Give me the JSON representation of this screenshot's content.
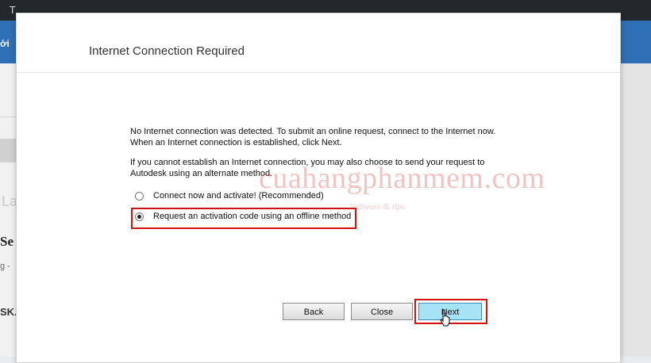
{
  "background": {
    "topbar_glyph": "T",
    "bluebar_text": "ới",
    "left_fragments": [
      "La",
      "Se",
      "g -",
      "SK."
    ]
  },
  "dialog": {
    "title": "Internet Connection Required",
    "message_1": "No Internet connection was detected. To submit an online request, connect to the Internet now. When an Internet connection is established, click Next.",
    "message_2": "If you cannot establish an Internet connection, you may also choose to send your request to Autodesk using an alternate method.",
    "options": [
      {
        "label": "Connect now and activate! (Recommended)",
        "selected": false
      },
      {
        "label": "Request an activation code using an offline method",
        "selected": true
      }
    ],
    "buttons": {
      "back": "Back",
      "close": "Close",
      "next": "Next"
    }
  },
  "watermark": {
    "main": "cuahangphanmem.com",
    "sub": "Software & tips"
  },
  "colors": {
    "highlight": "#d01414",
    "next_button": "#a7e3f7",
    "header_blue": "#2f6fb5"
  }
}
